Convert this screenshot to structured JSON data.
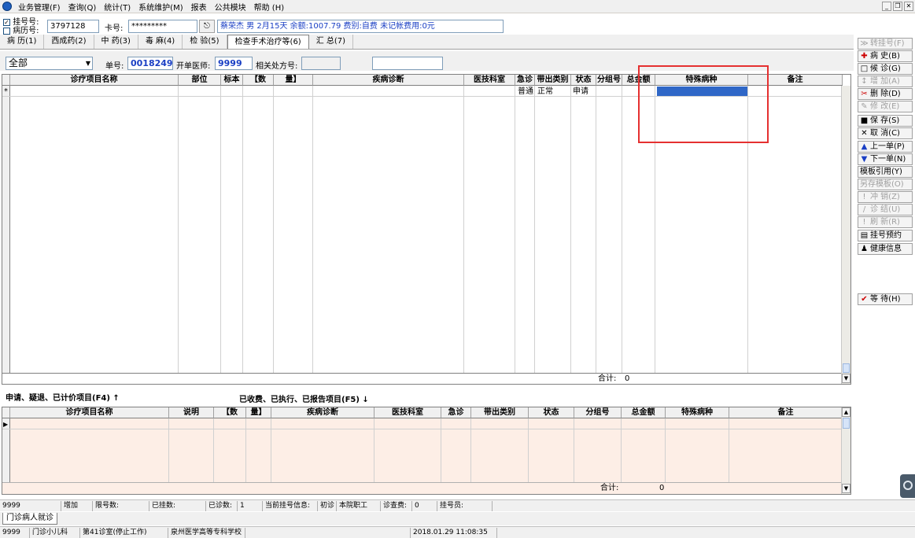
{
  "menu": [
    "业务管理(F)",
    "查询(Q)",
    "统计(T)",
    "系统维护(M)",
    "报表",
    "公共模块",
    "帮助 (H)"
  ],
  "reg": {
    "guahao_label": "挂号号:",
    "binglihao_label": "病历号:",
    "number_value": "3797128",
    "card_label": "卡号:",
    "card_value": "*********",
    "patient_info": "蔡荣杰 男 2月15天 余额:1007.79 费别:自费 未记帐费用:0元"
  },
  "tabs": [
    "病 历(1)",
    "西成药(2)",
    "中 药(3)",
    "毒 麻(4)",
    "检 验(5)",
    "检查手术治疗等(6)",
    "汇 总(7)"
  ],
  "filter": {
    "dropdown_value": "全部",
    "dan_label": "单号:",
    "dan_value": "00182494",
    "doctor_label": "开单医师:",
    "doctor_value": "9999",
    "related_label": "相关处方号:"
  },
  "top_table": {
    "headers": [
      "诊疗项目名称",
      "部位",
      "标本",
      "【数",
      "量】",
      "疾病诊断",
      "医技科室",
      "急诊",
      "带出类别",
      "状态",
      "分组号",
      "总金额",
      "特殊病种",
      "备注"
    ],
    "row": {
      "marker": "*",
      "jizhen": "普通",
      "daichu": "正常",
      "status": "申请"
    },
    "total_label": "合计:",
    "total_value": "0"
  },
  "section": {
    "left": "申请、疑退、已计价项目(F4)",
    "right": "已收费、已执行、已报告项目(F5)"
  },
  "bottom_table": {
    "headers": [
      "诊疗项目名称",
      "说明",
      "【数",
      "量】",
      "疾病诊断",
      "医技科室",
      "急诊",
      "带出类别",
      "状态",
      "分组号",
      "总金额",
      "特殊病种",
      "备注"
    ],
    "total_label": "合计:",
    "total_value": "0"
  },
  "side_buttons": [
    {
      "label": "转挂号(F)",
      "icon": "≫",
      "enabled": false
    },
    {
      "label": "病  史(B)",
      "icon": "✚",
      "enabled": true
    },
    {
      "label": "候  诊(G)",
      "icon": "□",
      "enabled": true
    },
    {
      "label": "增  加(A)",
      "icon": "↕",
      "enabled": false
    },
    {
      "label": "删  除(D)",
      "icon": "✂",
      "enabled": true
    },
    {
      "label": "修  改(E)",
      "icon": "✎",
      "enabled": false
    },
    {
      "label": "保  存(S)",
      "icon": "■",
      "enabled": true
    },
    {
      "label": "取  消(C)",
      "icon": "✕",
      "enabled": true
    },
    {
      "label": "上一单(P)",
      "icon": "▲",
      "enabled": true
    },
    {
      "label": "下一单(N)",
      "icon": "▼",
      "enabled": true
    },
    {
      "label": "模板引用(Y)",
      "icon": "",
      "enabled": true
    },
    {
      "label": "另存模板(O)",
      "icon": "",
      "enabled": false
    },
    {
      "label": "冲  销(Z)",
      "icon": "!",
      "enabled": false
    },
    {
      "label": "诊  结(U)",
      "icon": "/",
      "enabled": false
    },
    {
      "label": "刷  新(R)",
      "icon": "!",
      "enabled": false
    },
    {
      "label": "挂号预约",
      "icon": "▤",
      "enabled": true
    },
    {
      "label": "健康信息",
      "icon": "♟",
      "enabled": true
    },
    {
      "label": "等  待(H)",
      "icon": "✔",
      "enabled": true
    }
  ],
  "status1": {
    "user": "9999",
    "mode": "增加",
    "limit_label": "限号数:",
    "registered_label": "已挂数:",
    "diagnosed_label": "已诊数:",
    "diagnosed_value": "1",
    "current_label": "当前挂号信息:",
    "first_visit": "初诊",
    "staff": "本院职工",
    "fee_label": "诊查费:",
    "fee_value": "0",
    "reg_clerk_label": "挂号员:"
  },
  "tab_outpatient": "门诊病人就诊",
  "status2": {
    "user": "9999",
    "dept": "门诊小儿科",
    "room": "第41诊室(停止工作)",
    "org": "泉州医学高等专科学校",
    "datetime": "2018.01.29 11:08:35"
  },
  "colors": {
    "highlight": "#2f67c7",
    "red_box": "#e53030",
    "pink": "#fdeee6"
  }
}
